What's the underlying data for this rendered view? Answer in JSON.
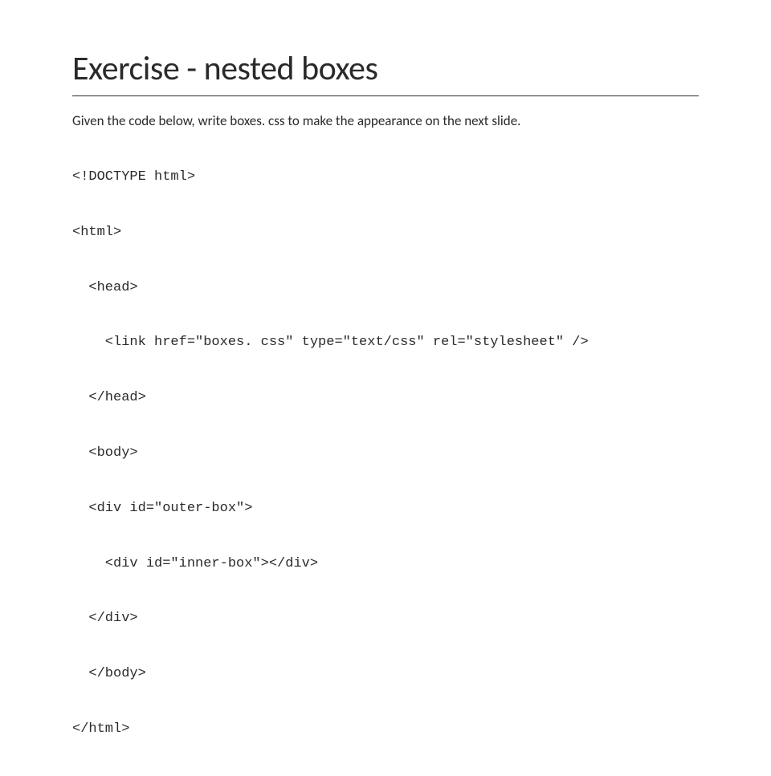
{
  "title": "Exercise - nested boxes",
  "instruction": "Given the code below, write boxes. css to make the appearance on the next slide.",
  "code": {
    "line1": "<!DOCTYPE html>",
    "line2": "<html>",
    "line3": "  <head>",
    "line4": "    <link href=\"boxes. css\" type=\"text/css\" rel=\"stylesheet\" />",
    "line5": "  </head>",
    "line6": "  <body>",
    "line7": "  <div id=\"outer-box\">",
    "line8": "    <div id=\"inner-box\"></div>",
    "line9": "  </div>",
    "line10": "  </body>",
    "line11": "</html>"
  }
}
